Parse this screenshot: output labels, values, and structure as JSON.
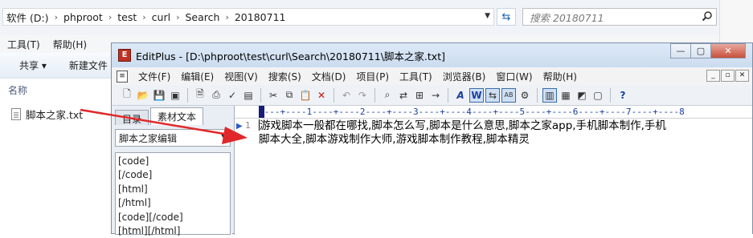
{
  "explorer": {
    "breadcrumb": [
      "软件 (D:)",
      "phproot",
      "test",
      "curl",
      "Search",
      "20180711"
    ],
    "search_placeholder": "搜索 20180711",
    "menu": [
      "工具(T)",
      "帮助(H)"
    ],
    "commands": [
      "共享 ▾",
      "新建文件"
    ],
    "column_header": "名称",
    "file_name": "脚本之家.txt"
  },
  "editplus": {
    "title": "EditPlus - [D:\\phproot\\test\\curl\\Search\\20180711\\脚本之家.txt]",
    "menu": [
      "文件(F)",
      "编辑(E)",
      "视图(V)",
      "搜索(S)",
      "文档(D)",
      "项目(P)",
      "工具(T)",
      "浏览器(B)",
      "窗口(W)",
      "帮助(H)"
    ],
    "tabs": [
      "目录",
      "素材文本"
    ],
    "cliptext_selected": "脚本之家编辑",
    "cliptext_items": [
      "[code]",
      "[/code]",
      "[html]",
      "[/html]",
      "[code][/code]",
      "[html][/html]"
    ],
    "ruler": "----+----1----+----2----+----3----+----4----+----5----+----6----+----7----+----8",
    "line_number": "1",
    "line1_part1": "游戏脚本一般都在哪找,脚本怎么写,脚本是什么意思,脚本之家app,手机脚本制作,手机",
    "line1_part2": "脚本大全,脚本游戏制作大师,游戏脚本制作教程,脚本精灵"
  },
  "colors": {
    "arrow": "#e0282a",
    "title_bar": "#cbdcef",
    "link_blue": "#1a3fa0"
  }
}
